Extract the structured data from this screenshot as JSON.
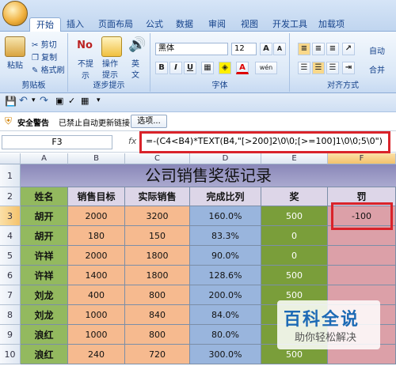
{
  "tabs": [
    "开始",
    "插入",
    "页面布局",
    "公式",
    "数据",
    "审阅",
    "视图",
    "开发工具",
    "加载项"
  ],
  "ribbon": {
    "clipboard": {
      "label": "剪贴板",
      "paste": "粘贴",
      "cut": "剪切",
      "copy": "复制",
      "format_painter": "格式刷"
    },
    "steps": {
      "label": "逐步提示",
      "no_hint": "不提示",
      "operation": "操作",
      "hint": "提示",
      "en": "英",
      "text": "文"
    },
    "font": {
      "label": "字体",
      "font_name": "黑体",
      "font_size": "12",
      "bold": "B",
      "italic": "I",
      "underline": "U",
      "font_color_letter": "A",
      "inc": "A",
      "dec": "A",
      "phonetic": "wén"
    },
    "align": {
      "label": "对齐方式",
      "auto": "自动",
      "merge": "合并"
    }
  },
  "security": {
    "label": "安全警告",
    "message": "已禁止自动更新链接",
    "options": "选项..."
  },
  "formula_bar": {
    "cell_ref": "F3",
    "fx": "fx",
    "formula": "=-(C4<B4)*TEXT(B4,\"[>200]2\\0\\0;[>=100]1\\0\\0;5\\0\")"
  },
  "columns": [
    "A",
    "B",
    "C",
    "D",
    "E",
    "F"
  ],
  "rows": [
    "1",
    "2",
    "3",
    "4",
    "5",
    "6",
    "7",
    "8",
    "9",
    "10"
  ],
  "sheet": {
    "title": "公司销售奖惩记录",
    "headers": [
      "姓名",
      "销售目标",
      "实际销售",
      "完成比列",
      "奖",
      "罚"
    ],
    "data": [
      {
        "name": "胡开",
        "target": "2000",
        "actual": "3200",
        "ratio": "160.0%",
        "reward": "500",
        "penalty": "-100"
      },
      {
        "name": "胡开",
        "target": "180",
        "actual": "150",
        "ratio": "83.3%",
        "reward": "0",
        "penalty": ""
      },
      {
        "name": "许祥",
        "target": "2000",
        "actual": "1800",
        "ratio": "90.0%",
        "reward": "0",
        "penalty": ""
      },
      {
        "name": "许祥",
        "target": "1400",
        "actual": "1800",
        "ratio": "128.6%",
        "reward": "500",
        "penalty": ""
      },
      {
        "name": "刘龙",
        "target": "400",
        "actual": "800",
        "ratio": "200.0%",
        "reward": "500",
        "penalty": ""
      },
      {
        "name": "刘龙",
        "target": "1000",
        "actual": "840",
        "ratio": "84.0%",
        "reward": "",
        "penalty": ""
      },
      {
        "name": "浪红",
        "target": "1000",
        "actual": "800",
        "ratio": "80.0%",
        "reward": "",
        "penalty": ""
      },
      {
        "name": "浪红",
        "target": "240",
        "actual": "720",
        "ratio": "300.0%",
        "reward": "500",
        "penalty": ""
      }
    ]
  },
  "watermark": {
    "title": "百科全说",
    "subtitle": "助你轻松解决"
  }
}
